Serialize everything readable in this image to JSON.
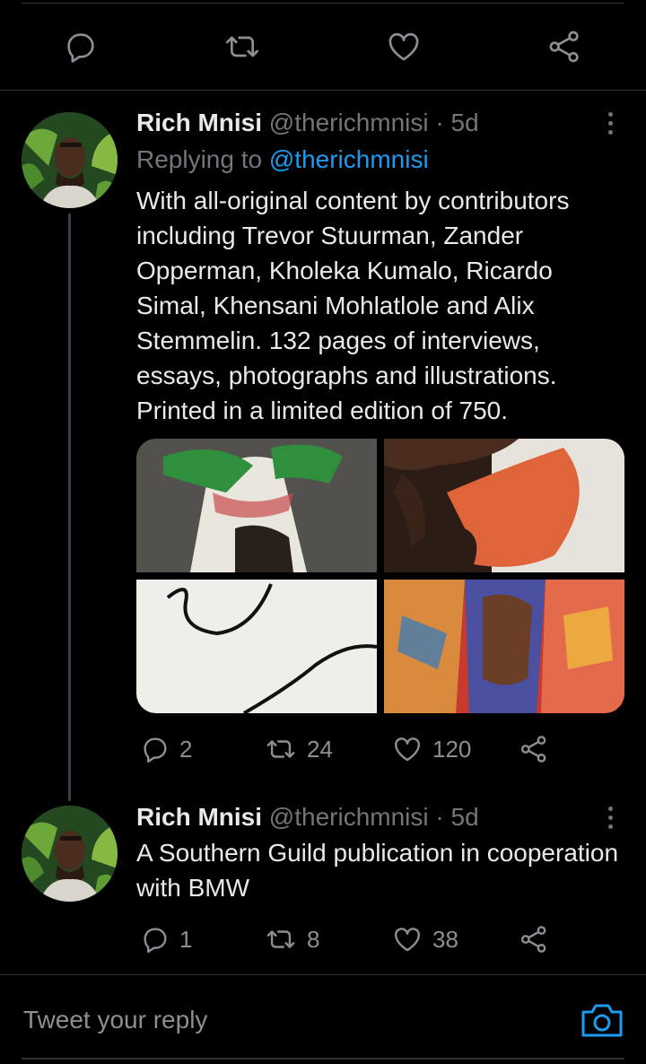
{
  "colors": {
    "background": "#000000",
    "text": "#e7e9ea",
    "muted": "#71767b",
    "link": "#1d9bf0",
    "divider": "#2f3336"
  },
  "top_actions": [
    {
      "icon": "reply-icon"
    },
    {
      "icon": "retweet-icon"
    },
    {
      "icon": "like-icon"
    },
    {
      "icon": "share-icon"
    }
  ],
  "tweets": [
    {
      "author_name": "Rich Mnisi",
      "author_handle": "@therichmnisi",
      "separator": "·",
      "time": "5d",
      "replying_prefix": "Replying to",
      "replying_mention": "@therichmnisi",
      "text": "With all-original content by contributors including Trevor Stuurman, Zander Opperman, Kholeka Kumalo, Ricardo Simal, Khensani Mohlatlole and Alix Stemmelin. 132 pages of interviews, essays, photographs and illustrations. Printed in a limited edition of 750.",
      "media_count": 4,
      "stats": {
        "replies": "2",
        "retweets": "24",
        "likes": "120"
      }
    },
    {
      "author_name": "Rich Mnisi",
      "author_handle": "@therichmnisi",
      "separator": "·",
      "time": "5d",
      "text": "A Southern Guild publication in cooperation with BMW",
      "stats": {
        "replies": "1",
        "retweets": "8",
        "likes": "38"
      }
    }
  ],
  "reply_bar": {
    "placeholder": "Tweet your reply",
    "camera_icon": "camera-icon"
  }
}
